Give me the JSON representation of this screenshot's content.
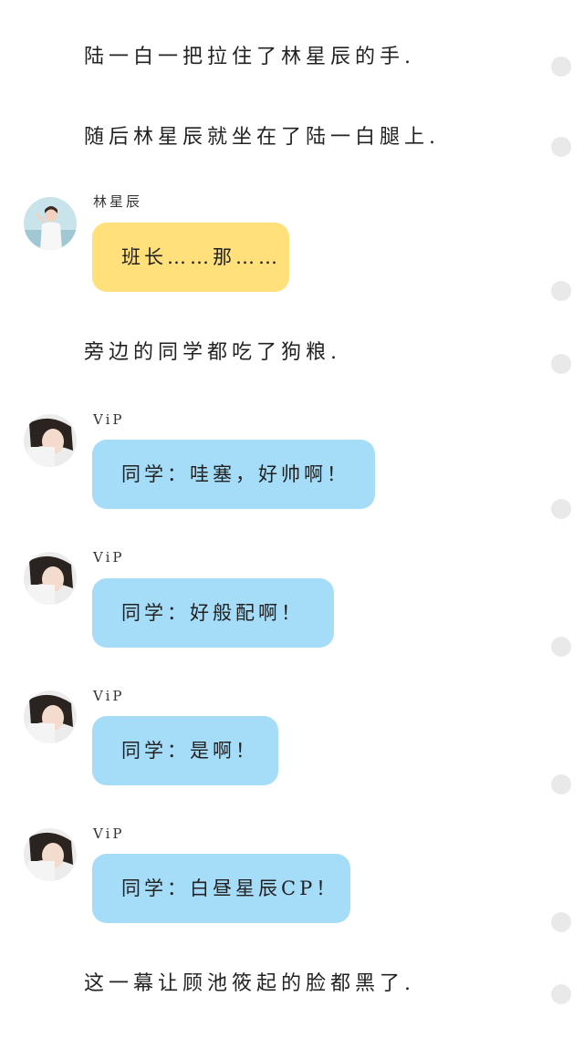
{
  "narration": [
    "陆一白一把拉住了林星辰的手.",
    "随后林星辰就坐在了陆一白腿上.",
    "旁边的同学都吃了狗粮.",
    "这一幕让顾池筱起的脸都黑了."
  ],
  "messages": [
    {
      "sender": "林星辰",
      "text": "班长……那……",
      "bubble_color": "#ffe07a",
      "avatar": "girl-standing-avatar"
    },
    {
      "sender": "ViP",
      "text": "同学：哇塞，好帅啊！",
      "bubble_color": "#a5dcf8",
      "avatar": "girl-selfie-avatar"
    },
    {
      "sender": "ViP",
      "text": "同学：好般配啊！",
      "bubble_color": "#a5dcf8",
      "avatar": "girl-selfie-avatar"
    },
    {
      "sender": "ViP",
      "text": "同学：是啊！",
      "bubble_color": "#a5dcf8",
      "avatar": "girl-selfie-avatar"
    },
    {
      "sender": "ViP",
      "text": "同学：白昼星辰CP！",
      "bubble_color": "#a5dcf8",
      "avatar": "girl-selfie-avatar"
    }
  ],
  "colors": {
    "yellow_bubble": "#ffe07a",
    "blue_bubble": "#a5dcf8",
    "side_dot": "#e9e9e9"
  }
}
